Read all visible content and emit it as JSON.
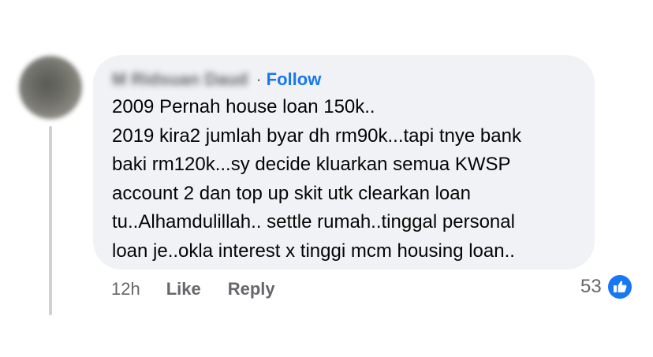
{
  "comment": {
    "author_name": "M Ridsuan Daud",
    "separator": "·",
    "follow_label": "Follow",
    "lines": [
      "2009 Pernah house loan 150k..",
      "2019 kira2 jumlah byar dh rm90k...tapi tnye bank",
      "baki rm120k...sy decide kluarkan semua KWSP",
      "account 2 dan top up skit utk clearkan loan",
      "tu..Alhamdulillah.. settle rumah..tinggal personal",
      "loan je..okla interest x tinggi mcm housing loan.."
    ]
  },
  "actions": {
    "time": "12h",
    "like_label": "Like",
    "reply_label": "Reply"
  },
  "reactions": {
    "count": "53",
    "icon": "thumbs-up-icon"
  },
  "colors": {
    "bubble_bg": "#f0f2f5",
    "follow_blue": "#1877f2",
    "secondary_text": "#65676b",
    "primary_text": "#050505"
  }
}
